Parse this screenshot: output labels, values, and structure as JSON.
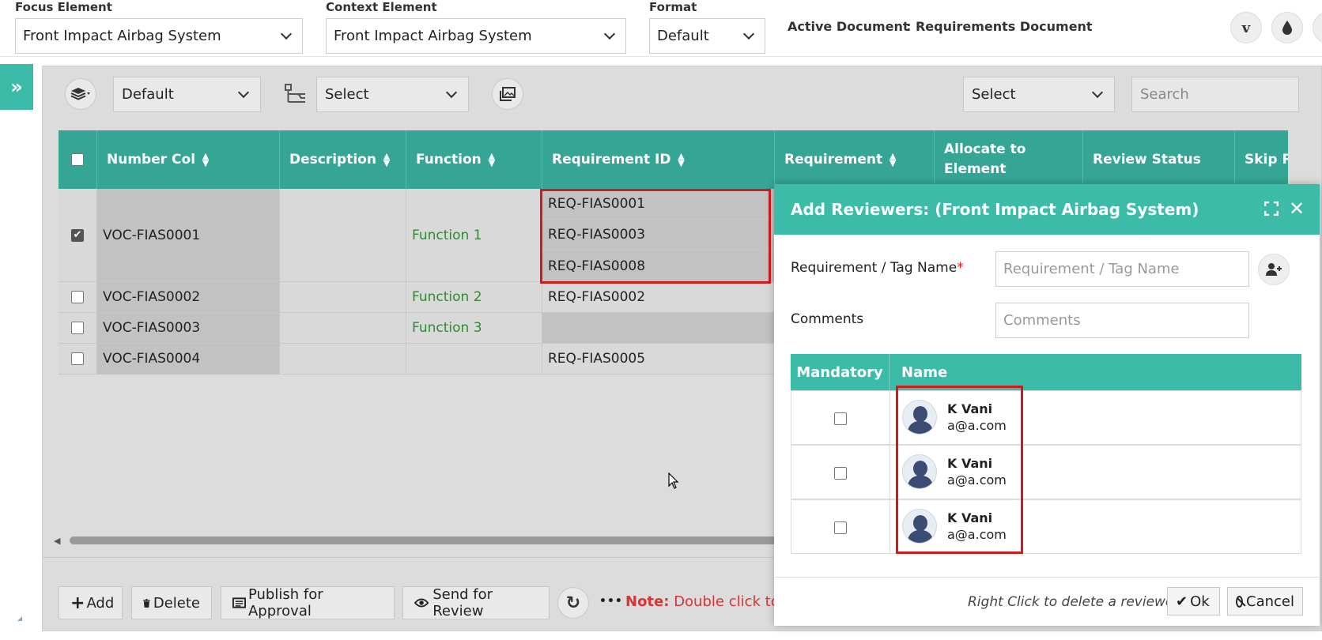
{
  "topbar": {
    "focus_label": "Focus Element",
    "focus_value": "Front Impact Airbag System",
    "context_label": "Context Element",
    "context_value": "Front Impact Airbag System",
    "format_label": "Format",
    "format_value": "Default",
    "active_doc_label": "Active Document",
    "active_doc_value": ": Requirements Document",
    "right_icons": [
      "vimeo-icon",
      "droplet-icon"
    ]
  },
  "sidebar_toggle": "»",
  "toolbar": {
    "layer_select": "Default",
    "hierarchy_select": "Select",
    "right_select": "Select",
    "search_placeholder": "Search"
  },
  "grid": {
    "columns": [
      "Number Col",
      "Description",
      "Function",
      "Requirement ID",
      "Requirement",
      "Allocate to Element",
      "Review Status",
      "Skip Re"
    ],
    "rows": [
      {
        "checked": true,
        "number": "VOC-FIAS0001",
        "description": "",
        "function": "Function 1",
        "req_ids": [
          "REQ-FIAS0001",
          "REQ-FIAS0003",
          "REQ-FIAS0008"
        ]
      },
      {
        "checked": false,
        "number": "VOC-FIAS0002",
        "description": "",
        "function": "Function 2",
        "req_ids": [
          "REQ-FIAS0002"
        ]
      },
      {
        "checked": false,
        "number": "VOC-FIAS0003",
        "description": "",
        "function": "Function 3",
        "req_ids": [
          ""
        ]
      },
      {
        "checked": false,
        "number": "VOC-FIAS0004",
        "description": "",
        "function": "",
        "req_ids": [
          "REQ-FIAS0005"
        ]
      }
    ]
  },
  "bottom_bar": {
    "add": "Add",
    "delete": "Delete",
    "publish": "Publish for Approval",
    "send_review": "Send for Review",
    "more": "•••",
    "note_label": "Note:",
    "note_text": "Double click to e"
  },
  "modal": {
    "title": "Add Reviewers: (Front Impact Airbag System)",
    "tag_label": "Requirement / Tag Name",
    "required_mark": "*",
    "tag_placeholder": "Requirement / Tag Name",
    "comments_label": "Comments",
    "comments_placeholder": "Comments",
    "col_mandatory": "Mandatory",
    "col_name": "Name",
    "reviewers": [
      {
        "name": "K Vani",
        "email": "a@a.com",
        "mandatory": false
      },
      {
        "name": "K Vani",
        "email": "a@a.com",
        "mandatory": false
      },
      {
        "name": "K Vani",
        "email": "a@a.com",
        "mandatory": false
      }
    ],
    "hint": "Right Click to delete a reviewer",
    "ok": "Ok",
    "cancel": "Cancel"
  }
}
